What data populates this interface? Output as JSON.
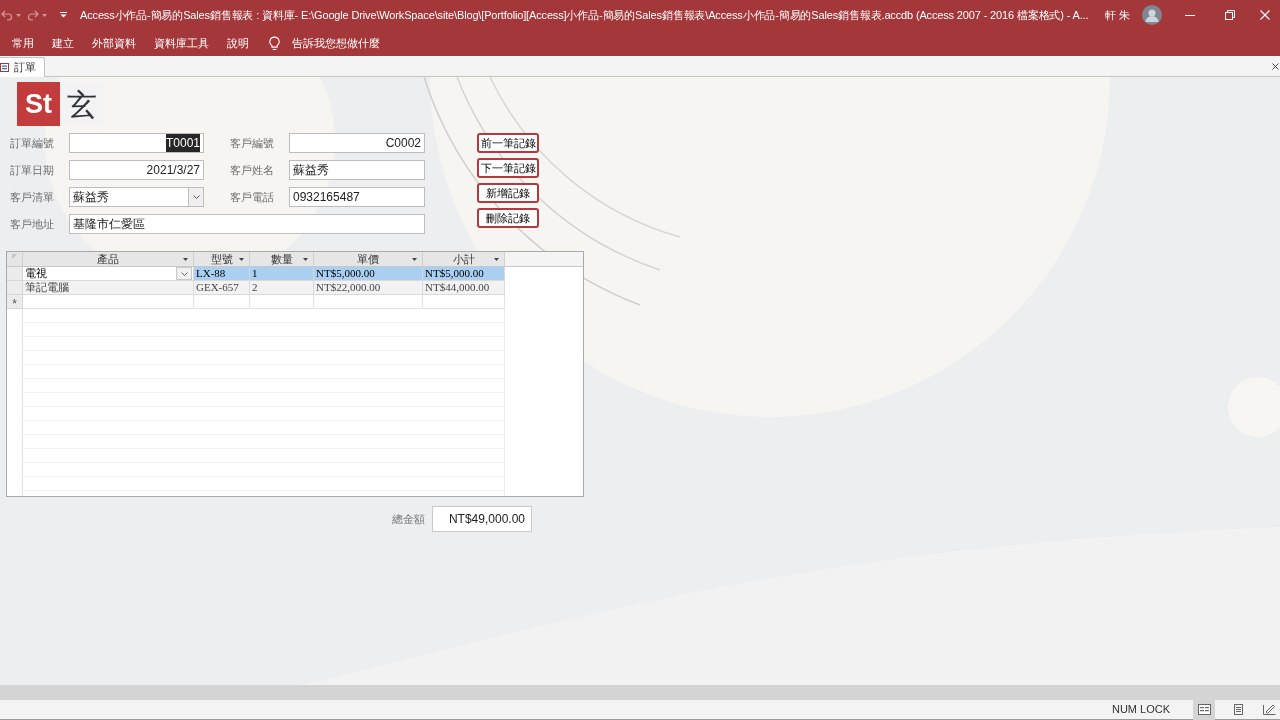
{
  "title_bar": {
    "title": "Access小作品-簡易的Sales銷售報表 : 資料庫- E:\\Google Drive\\WorkSpace\\site\\Blog\\[Portfolio][Access]小作品-簡易的Sales銷售報表\\Access小作品-簡易的Sales銷售報表.accdb (Access 2007 - 2016 檔案格式) - A...",
    "user": "軒 朱"
  },
  "ribbon": {
    "tabs": [
      {
        "label": "常用"
      },
      {
        "label": "建立"
      },
      {
        "label": "外部資料"
      },
      {
        "label": "資料庫工具"
      },
      {
        "label": "說明"
      }
    ],
    "tell_me": "告訴我您想做什麼"
  },
  "document_tabs": [
    {
      "label": "訂單",
      "selected": true
    }
  ],
  "form": {
    "logo": {
      "badge": "St",
      "text": "玄"
    },
    "field_rows": [
      [
        {
          "label": "訂單編號",
          "value": "T0001",
          "kind": "number",
          "highlighted": true
        },
        {
          "label": "客戶編號",
          "value": "C0002",
          "kind": "number",
          "highlighted": false
        }
      ],
      [
        {
          "label": "訂單日期",
          "value": "2021/3/27",
          "kind": "number",
          "highlighted": false
        },
        {
          "label": "客戶姓名",
          "value": "蘇益秀",
          "kind": "text",
          "highlighted": false
        }
      ],
      [
        {
          "label": "客戶清單",
          "value": "蘇益秀",
          "kind": "combo",
          "highlighted": false
        },
        {
          "label": "客戶電話",
          "value": "0932165487",
          "kind": "text",
          "highlighted": false
        }
      ],
      [
        {
          "label": "客戶地址",
          "value": "基隆市仁愛區",
          "kind": "text",
          "highlighted": false
        }
      ]
    ],
    "buttons": [
      "前一筆記錄",
      "下一筆記錄",
      "新增記錄",
      "刪除記錄"
    ],
    "datasheet": {
      "columns": [
        "產品",
        "型號",
        "數量",
        "單價",
        "小計"
      ],
      "rows": [
        {
          "selected": true,
          "cells": [
            "電視",
            "LX-88",
            "1",
            "NT$5,000.00",
            "NT$5,000.00"
          ]
        },
        {
          "selected": false,
          "cells": [
            "筆記電腦",
            "GEX-657",
            "2",
            "NT$22,000.00",
            "NT$44,000.00"
          ]
        }
      ],
      "new_record_marker": "*"
    },
    "total": {
      "label": "總金額",
      "value": "NT$49,000.00"
    }
  },
  "status_bar": {
    "indicator": "NUM LOCK",
    "views": [
      {
        "kind": "form",
        "selected": true
      },
      {
        "kind": "layout",
        "selected": false
      },
      {
        "kind": "design",
        "selected": false
      }
    ]
  }
}
